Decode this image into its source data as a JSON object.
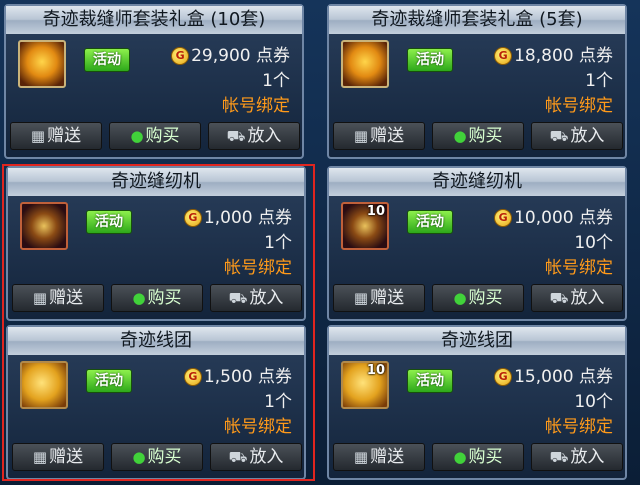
{
  "colors": {
    "background": "#0d2340",
    "title_bar": "#c3cfdc",
    "bind_text": "#ff9a1a",
    "badge": "#2da81a",
    "selection": "#e0251f"
  },
  "labels": {
    "badge": "活动",
    "gift": "赠送",
    "buy": "购买",
    "cart": "放入",
    "currency_icon": "G"
  },
  "icons": {
    "gift": "gift-icon",
    "buy": "money-bag-icon",
    "cart": "cart-icon",
    "currency": "coin-icon"
  },
  "items": [
    {
      "title": "奇迹裁缝师套装礼盒 (10套)",
      "price": "29,900 点券",
      "count": "1个",
      "bind": "帐号绑定",
      "icon": "gift-box-icon",
      "qty_badge": ""
    },
    {
      "title": "奇迹裁缝师套装礼盒 (5套)",
      "price": "18,800 点券",
      "count": "1个",
      "bind": "帐号绑定",
      "icon": "gift-box-icon",
      "qty_badge": ""
    },
    {
      "title": "奇迹缝纫机",
      "price": "1,000 点券",
      "count": "1个",
      "bind": "帐号绑定",
      "icon": "sewing-machine-icon",
      "qty_badge": ""
    },
    {
      "title": "奇迹缝纫机",
      "price": "10,000 点券",
      "count": "10个",
      "bind": "帐号绑定",
      "icon": "sewing-machine-icon",
      "qty_badge": "10"
    },
    {
      "title": "奇迹线团",
      "price": "1,500 点券",
      "count": "1个",
      "bind": "帐号绑定",
      "icon": "yarn-ball-icon",
      "qty_badge": ""
    },
    {
      "title": "奇迹线团",
      "price": "15,000 点券",
      "count": "10个",
      "bind": "帐号绑定",
      "icon": "yarn-ball-icon",
      "qty_badge": "10"
    }
  ]
}
